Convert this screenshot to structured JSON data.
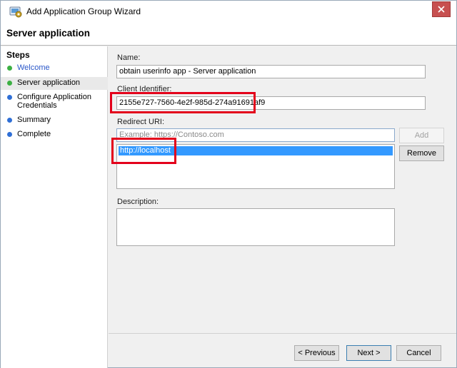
{
  "window": {
    "title": "Add Application Group Wizard"
  },
  "header": {
    "title": "Server application"
  },
  "steps": {
    "title": "Steps",
    "items": [
      {
        "label": "Welcome",
        "state": "done",
        "color": "#3cb043"
      },
      {
        "label": "Server application",
        "state": "current",
        "color": "#3cb043"
      },
      {
        "label": "Configure Application Credentials",
        "state": "pending",
        "color": "#2f6fd6"
      },
      {
        "label": "Summary",
        "state": "pending",
        "color": "#2f6fd6"
      },
      {
        "label": "Complete",
        "state": "pending",
        "color": "#2f6fd6"
      }
    ]
  },
  "form": {
    "name_label": "Name:",
    "name_value": "obtain userinfo app - Server application",
    "client_id_label": "Client Identifier:",
    "client_id_value": "2155e727-7560-4e2f-985d-274a91691af9",
    "redirect_label": "Redirect URI:",
    "redirect_placeholder": "Example: https://Contoso.com",
    "redirect_list": [
      "http://localhost"
    ],
    "add_label": "Add",
    "remove_label": "Remove",
    "description_label": "Description:",
    "description_value": ""
  },
  "footer": {
    "previous_label": "< Previous",
    "next_label": "Next >",
    "cancel_label": "Cancel"
  },
  "colors": {
    "highlight_box": "#e3001b",
    "selection": "#3399ff",
    "link": "#2a57c9"
  }
}
